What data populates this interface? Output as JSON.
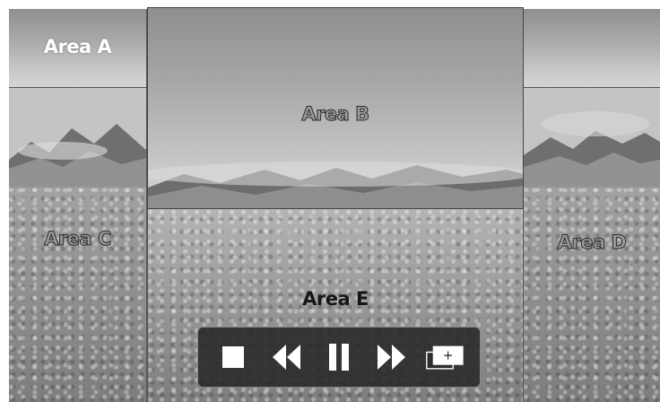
{
  "areas": {
    "a": {
      "label": "Area A"
    },
    "b": {
      "label": "Area B"
    },
    "c": {
      "label": "Area C"
    },
    "d": {
      "label": "Area D"
    },
    "e": {
      "label": "Area E"
    }
  },
  "controls": [
    {
      "name": "stop-icon"
    },
    {
      "name": "rewind-icon"
    },
    {
      "name": "pause-icon"
    },
    {
      "name": "fast-forward-icon"
    },
    {
      "name": "add-window-icon",
      "glyph": "+"
    }
  ],
  "colors": {
    "control_bar": "#2d2d2d",
    "icon": "#ffffff"
  }
}
